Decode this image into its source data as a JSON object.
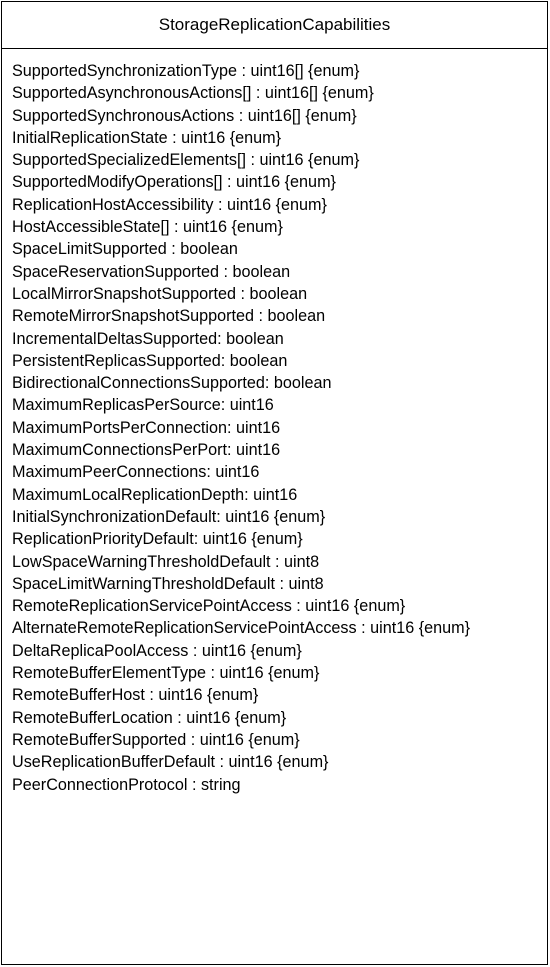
{
  "class_name": "StorageReplicationCapabilities",
  "attributes": [
    "SupportedSynchronizationType : uint16[] {enum}",
    "SupportedAsynchronousActions[] : uint16[] {enum}",
    "SupportedSynchronousActions : uint16[] {enum}",
    "InitialReplicationState : uint16 {enum}",
    "SupportedSpecializedElements[] : uint16 {enum}",
    "SupportedModifyOperations[] : uint16 {enum}",
    "ReplicationHostAccessibility : uint16 {enum}",
    "HostAccessibleState[] : uint16 {enum}",
    "SpaceLimitSupported : boolean",
    "SpaceReservationSupported : boolean",
    "LocalMirrorSnapshotSupported : boolean",
    "RemoteMirrorSnapshotSupported : boolean",
    "IncrementalDeltasSupported: boolean",
    "PersistentReplicasSupported: boolean",
    "BidirectionalConnectionsSupported: boolean",
    "MaximumReplicasPerSource: uint16",
    "MaximumPortsPerConnection: uint16",
    "MaximumConnectionsPerPort: uint16",
    "MaximumPeerConnections: uint16",
    "MaximumLocalReplicationDepth: uint16",
    "InitialSynchronizationDefault: uint16 {enum}",
    "ReplicationPriorityDefault: uint16 {enum}",
    "LowSpaceWarningThresholdDefault : uint8",
    "SpaceLimitWarningThresholdDefault : uint8",
    "RemoteReplicationServicePointAccess : uint16 {enum}",
    "AlternateRemoteReplicationServicePointAccess : uint16 {enum}",
    "DeltaReplicaPoolAccess : uint16 {enum}",
    "RemoteBufferElementType : uint16 {enum}",
    "RemoteBufferHost : uint16 {enum}",
    "RemoteBufferLocation : uint16 {enum}",
    "RemoteBufferSupported : uint16 {enum}",
    "UseReplicationBufferDefault : uint16 {enum}",
    "PeerConnectionProtocol : string"
  ]
}
